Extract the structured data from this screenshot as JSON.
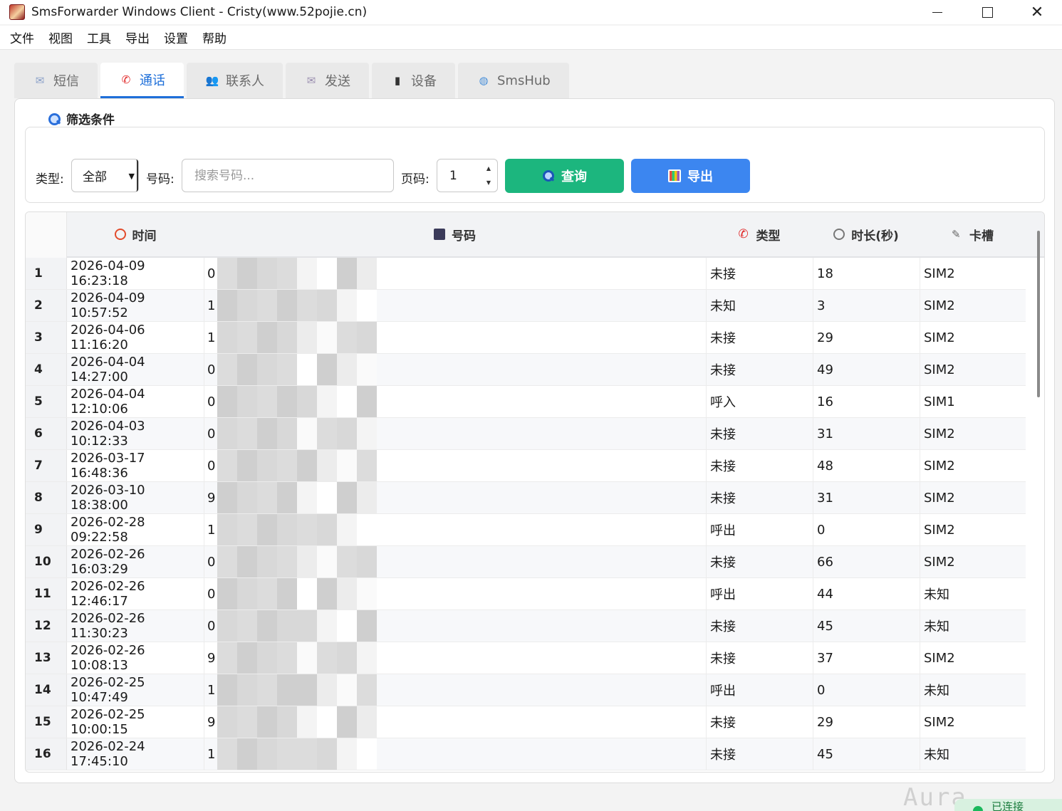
{
  "window": {
    "title": "SmsForwarder Windows Client - Cristy(www.52pojie.cn)",
    "minimize": "—",
    "maximize": "□",
    "close": "✕"
  },
  "menu": [
    "文件",
    "视图",
    "工具",
    "导出",
    "设置",
    "帮助"
  ],
  "tabs": [
    {
      "label": "短信",
      "icon": "sms-icon",
      "active": false
    },
    {
      "label": "通话",
      "icon": "phone-icon",
      "active": true
    },
    {
      "label": "联系人",
      "icon": "contacts-icon",
      "active": false
    },
    {
      "label": "发送",
      "icon": "envelope-icon",
      "active": false
    },
    {
      "label": "设备",
      "icon": "device-icon",
      "active": false
    },
    {
      "label": "SmsHub",
      "icon": "globe-icon",
      "active": false
    }
  ],
  "filter": {
    "title": "筛选条件",
    "type_label": "类型:",
    "type_value": "全部",
    "number_label": "号码:",
    "number_placeholder": "搜索号码...",
    "page_label": "页码:",
    "page_value": "1",
    "query_button": "查询",
    "export_button": "导出"
  },
  "table": {
    "columns": [
      "时间",
      "号码",
      "类型",
      "时长(秒)",
      "卡槽"
    ],
    "rows": [
      {
        "n": "1",
        "time": "2026-04-09 16:23:18",
        "num": "0",
        "type": "未接",
        "dur": "18",
        "sim": "SIM2"
      },
      {
        "n": "2",
        "time": "2026-04-09 10:57:52",
        "num": "1",
        "type": "未知",
        "dur": "3",
        "sim": "SIM2"
      },
      {
        "n": "3",
        "time": "2026-04-06 11:16:20",
        "num": "1",
        "type": "未接",
        "dur": "29",
        "sim": "SIM2"
      },
      {
        "n": "4",
        "time": "2026-04-04 14:27:00",
        "num": "0",
        "type": "未接",
        "dur": "49",
        "sim": "SIM2"
      },
      {
        "n": "5",
        "time": "2026-04-04 12:10:06",
        "num": "0",
        "type": "呼入",
        "dur": "16",
        "sim": "SIM1"
      },
      {
        "n": "6",
        "time": "2026-04-03 10:12:33",
        "num": "0",
        "type": "未接",
        "dur": "31",
        "sim": "SIM2"
      },
      {
        "n": "7",
        "time": "2026-03-17 16:48:36",
        "num": "0",
        "type": "未接",
        "dur": "48",
        "sim": "SIM2"
      },
      {
        "n": "8",
        "time": "2026-03-10 18:38:00",
        "num": "9",
        "type": "未接",
        "dur": "31",
        "sim": "SIM2"
      },
      {
        "n": "9",
        "time": "2026-02-28 09:22:58",
        "num": "1",
        "type": "呼出",
        "dur": "0",
        "sim": "SIM2"
      },
      {
        "n": "10",
        "time": "2026-02-26 16:03:29",
        "num": "0",
        "type": "未接",
        "dur": "66",
        "sim": "SIM2"
      },
      {
        "n": "11",
        "time": "2026-02-26 12:46:17",
        "num": "0",
        "type": "呼出",
        "dur": "44",
        "sim": "未知"
      },
      {
        "n": "12",
        "time": "2026-02-26 11:30:23",
        "num": "0",
        "type": "未接",
        "dur": "45",
        "sim": "未知"
      },
      {
        "n": "13",
        "time": "2026-02-26 10:08:13",
        "num": "9",
        "type": "未接",
        "dur": "37",
        "sim": "SIM2"
      },
      {
        "n": "14",
        "time": "2026-02-25 10:47:49",
        "num": "1",
        "type": "呼出",
        "dur": "0",
        "sim": "未知"
      },
      {
        "n": "15",
        "time": "2026-02-25 10:00:15",
        "num": "9",
        "type": "未接",
        "dur": "29",
        "sim": "SIM2"
      },
      {
        "n": "16",
        "time": "2026-02-24 17:45:10",
        "num": "1",
        "type": "未接",
        "dur": "45",
        "sim": "未知"
      }
    ]
  },
  "watermark": "Aura Service",
  "status": "已连接",
  "colors": {
    "accent": "#1e6fd9",
    "query": "#1cb67e",
    "export": "#3c86f0",
    "connected": "#1ab85c"
  }
}
